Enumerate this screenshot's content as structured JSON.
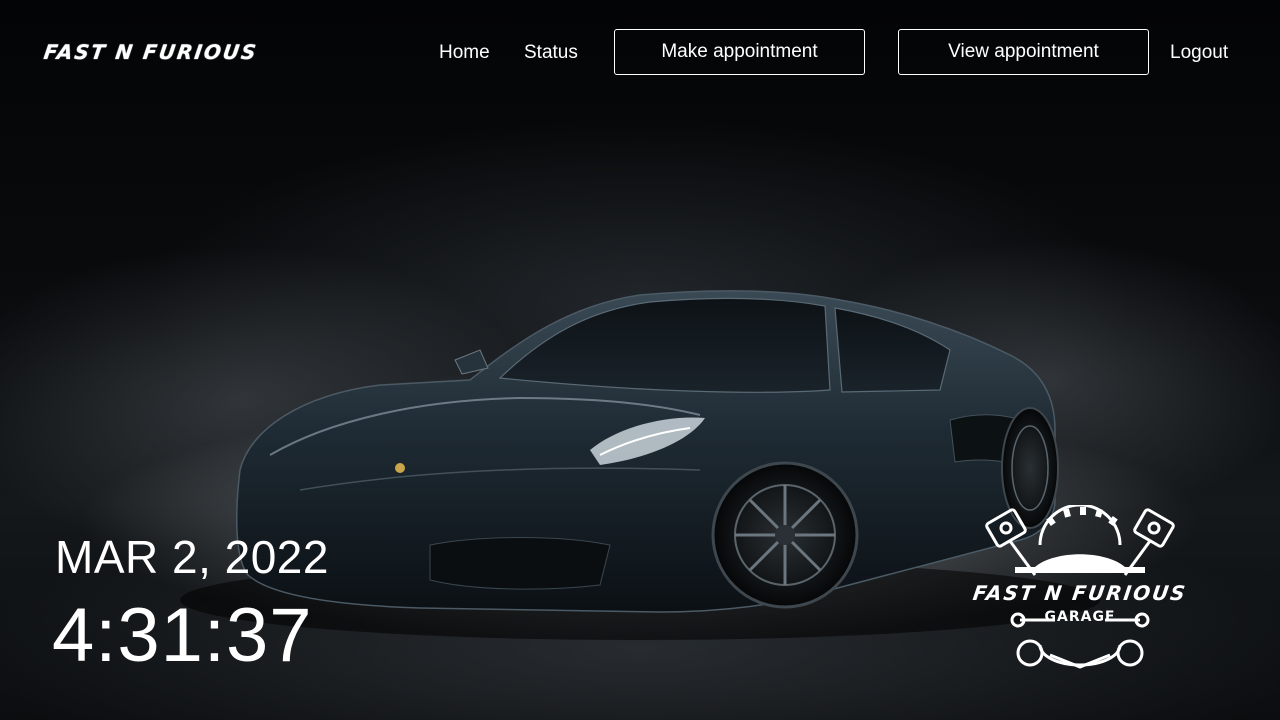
{
  "header": {
    "brand": "FAST N FURIOUS",
    "nav": {
      "home": "Home",
      "status": "Status",
      "make_appointment": "Make appointment",
      "view_appointment": "View appointment",
      "logout": "Logout"
    }
  },
  "clock": {
    "date": "MAR 2, 2022",
    "time": "4:31:37"
  },
  "emblem": {
    "title": "FAST N FURIOUS",
    "subtitle": "GARAGE",
    "icons": [
      "piston-icon",
      "gear-icon",
      "wrench-icon",
      "car-silhouette-icon"
    ]
  },
  "background": {
    "subject": "car-image",
    "colors": {
      "car_body": "#1e2a33",
      "smoke": "#cfd5da",
      "text": "#ffffff"
    }
  }
}
